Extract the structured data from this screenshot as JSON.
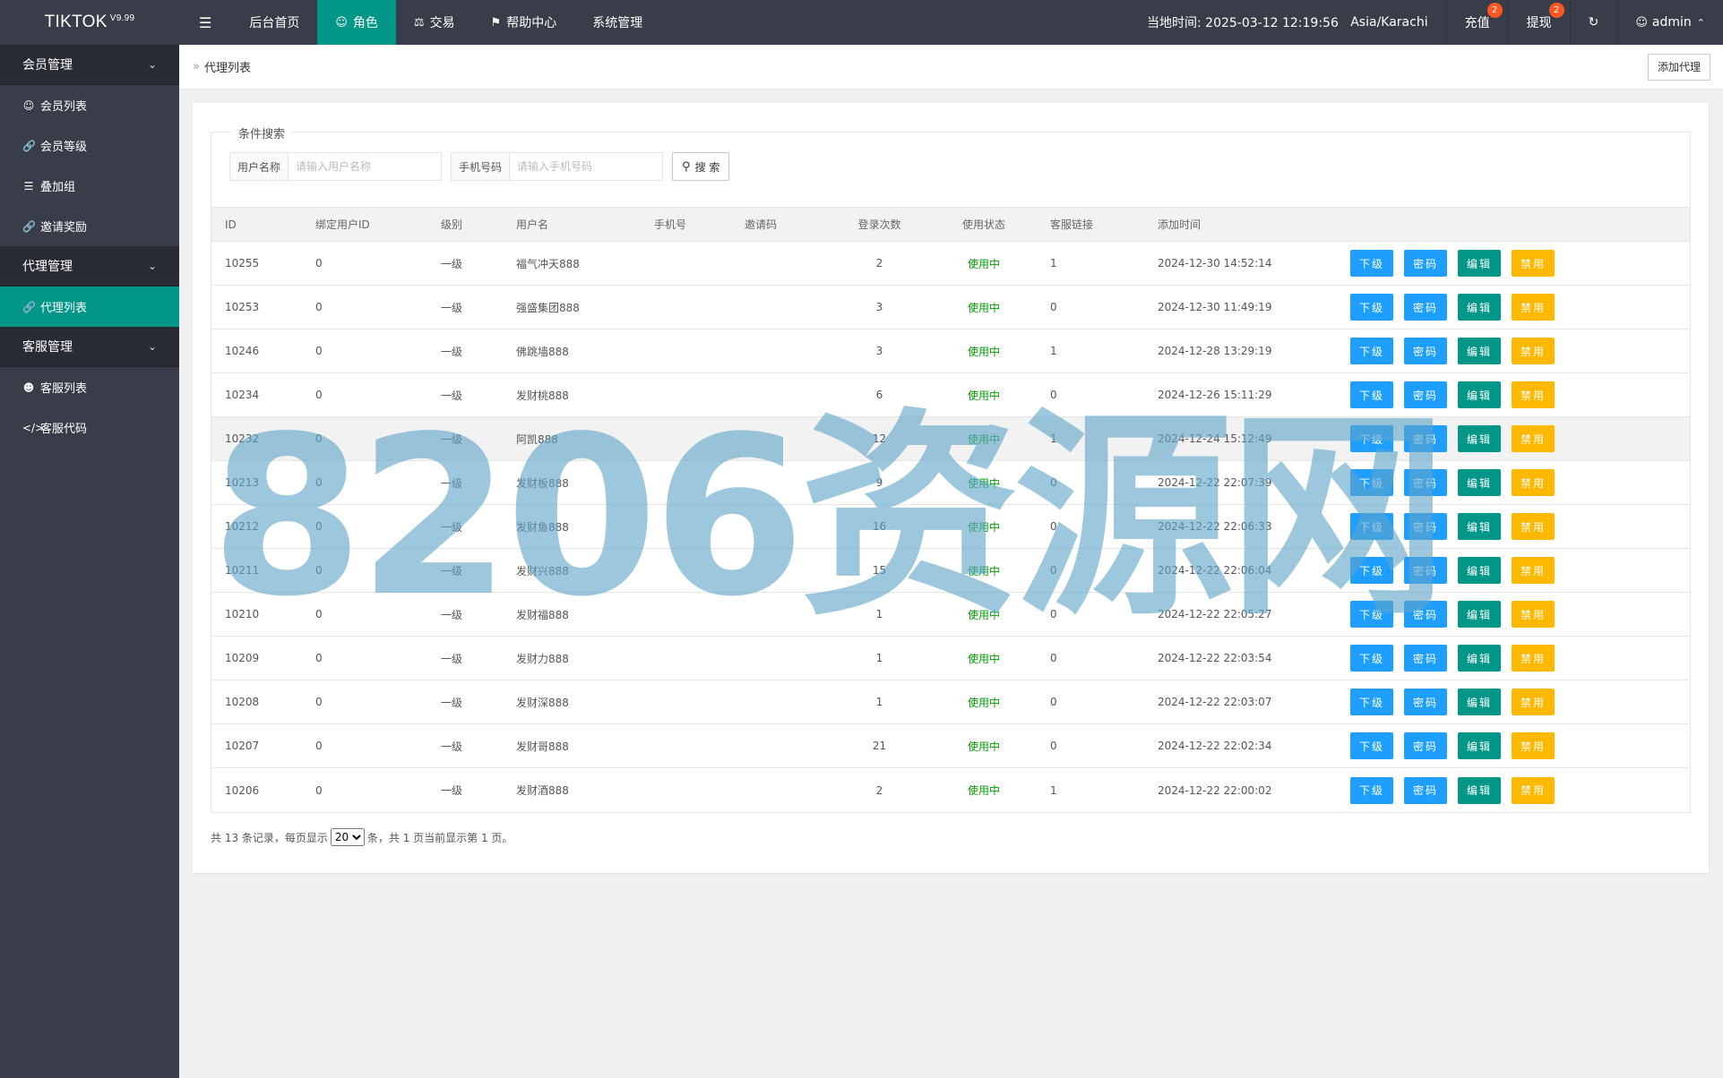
{
  "app": {
    "logo_text": "TIKTOK",
    "version": "V9.99"
  },
  "topnav": {
    "toggle_icon": "☰",
    "items": [
      {
        "label": "后台首页",
        "icon": ""
      },
      {
        "label": "角色",
        "icon": "user-icon"
      },
      {
        "label": "交易",
        "icon": "scale-icon"
      },
      {
        "label": "帮助中心",
        "icon": "flag-icon"
      },
      {
        "label": "系统管理",
        "icon": ""
      }
    ],
    "active_index": 1
  },
  "topright": {
    "time_label": "当地时间: 2025-03-12 12:19:56",
    "timezone": "Asia/Karachi",
    "recharge_label": "充值",
    "recharge_badge": "2",
    "withdraw_label": "提现",
    "withdraw_badge": "2",
    "refresh_icon": "↻",
    "user_name": "admin"
  },
  "sidebar": {
    "groups": [
      {
        "label": "会员管理",
        "items": [
          {
            "label": "会员列表",
            "icon": "user-icon"
          },
          {
            "label": "会员等级",
            "icon": "link-icon"
          },
          {
            "label": "叠加组",
            "icon": "list-icon"
          },
          {
            "label": "邀请奖励",
            "icon": "link-icon"
          }
        ]
      },
      {
        "label": "代理管理",
        "items": [
          {
            "label": "代理列表",
            "icon": "link-icon"
          }
        ]
      },
      {
        "label": "客服管理",
        "items": [
          {
            "label": "客服列表",
            "icon": "users-icon"
          },
          {
            "label": "客服代码",
            "icon": "code-icon"
          }
        ]
      }
    ],
    "active_item": "代理列表"
  },
  "breadcrumb": {
    "separator": "»",
    "title": "代理列表",
    "add_button": "添加代理"
  },
  "search": {
    "legend": "条件搜索",
    "username_label": "用户名称",
    "username_placeholder": "请输入用户名称",
    "username_value": "",
    "phone_label": "手机号码",
    "phone_placeholder": "请输入手机号码",
    "phone_value": "",
    "button_label": "搜 索"
  },
  "table": {
    "headers": [
      "ID",
      "绑定用户ID",
      "级别",
      "用户名",
      "手机号",
      "邀请码",
      "登录次数",
      "使用状态",
      "客服链接",
      "添加时间"
    ],
    "action_labels": [
      "下级",
      "密码",
      "编辑",
      "禁用"
    ],
    "rows": [
      {
        "id": "10255",
        "bind": "0",
        "level": "一级",
        "user": "福气冲天888",
        "phone": "",
        "invite": "",
        "logins": "2",
        "status": "使用中",
        "cs": "1",
        "time": "2024-12-30 14:52:14"
      },
      {
        "id": "10253",
        "bind": "0",
        "level": "一级",
        "user": "强盛集团888",
        "phone": "",
        "invite": "",
        "logins": "3",
        "status": "使用中",
        "cs": "0",
        "time": "2024-12-30 11:49:19"
      },
      {
        "id": "10246",
        "bind": "0",
        "level": "一级",
        "user": "佛跳墙888",
        "phone": "",
        "invite": "",
        "logins": "3",
        "status": "使用中",
        "cs": "1",
        "time": "2024-12-28 13:29:19"
      },
      {
        "id": "10234",
        "bind": "0",
        "level": "一级",
        "user": "发财桃888",
        "phone": "",
        "invite": "",
        "logins": "6",
        "status": "使用中",
        "cs": "0",
        "time": "2024-12-26 15:11:29"
      },
      {
        "id": "10232",
        "bind": "0",
        "level": "一级",
        "user": "阿凯888",
        "phone": "",
        "invite": "",
        "logins": "12",
        "status": "使用中",
        "cs": "1",
        "time": "2024-12-24 15:12:49"
      },
      {
        "id": "10213",
        "bind": "0",
        "level": "一级",
        "user": "发财板888",
        "phone": "",
        "invite": "",
        "logins": "9",
        "status": "使用中",
        "cs": "0",
        "time": "2024-12-22 22:07:39"
      },
      {
        "id": "10212",
        "bind": "0",
        "level": "一级",
        "user": "发财鱼888",
        "phone": "",
        "invite": "",
        "logins": "16",
        "status": "使用中",
        "cs": "0",
        "time": "2024-12-22 22:06:33"
      },
      {
        "id": "10211",
        "bind": "0",
        "level": "一级",
        "user": "发财兴888",
        "phone": "",
        "invite": "",
        "logins": "15",
        "status": "使用中",
        "cs": "0",
        "time": "2024-12-22 22:06:04"
      },
      {
        "id": "10210",
        "bind": "0",
        "level": "一级",
        "user": "发财福888",
        "phone": "",
        "invite": "",
        "logins": "1",
        "status": "使用中",
        "cs": "0",
        "time": "2024-12-22 22:05:27"
      },
      {
        "id": "10209",
        "bind": "0",
        "level": "一级",
        "user": "发财力888",
        "phone": "",
        "invite": "",
        "logins": "1",
        "status": "使用中",
        "cs": "0",
        "time": "2024-12-22 22:03:54"
      },
      {
        "id": "10208",
        "bind": "0",
        "level": "一级",
        "user": "发财深888",
        "phone": "",
        "invite": "",
        "logins": "1",
        "status": "使用中",
        "cs": "0",
        "time": "2024-12-22 22:03:07"
      },
      {
        "id": "10207",
        "bind": "0",
        "level": "一级",
        "user": "发财哥888",
        "phone": "",
        "invite": "",
        "logins": "21",
        "status": "使用中",
        "cs": "0",
        "time": "2024-12-22 22:02:34"
      },
      {
        "id": "10206",
        "bind": "0",
        "level": "一级",
        "user": "发财酒888",
        "phone": "",
        "invite": "",
        "logins": "2",
        "status": "使用中",
        "cs": "1",
        "time": "2024-12-22 22:00:02"
      }
    ],
    "hover_row_index": 4
  },
  "pager": {
    "prefix": "共 13 条记录，每页显示",
    "page_size": "20",
    "page_size_options": [
      "20"
    ],
    "suffix": "条，共 1 页当前显示第 1 页。"
  },
  "watermark": {
    "text": "8206资源网"
  },
  "colors": {
    "topbar": "#393d49",
    "accent": "#009688",
    "btn_blue": "#1e9fff",
    "btn_orange": "#ffb800",
    "status_green": "#00a000",
    "badge": "#ff5722"
  }
}
